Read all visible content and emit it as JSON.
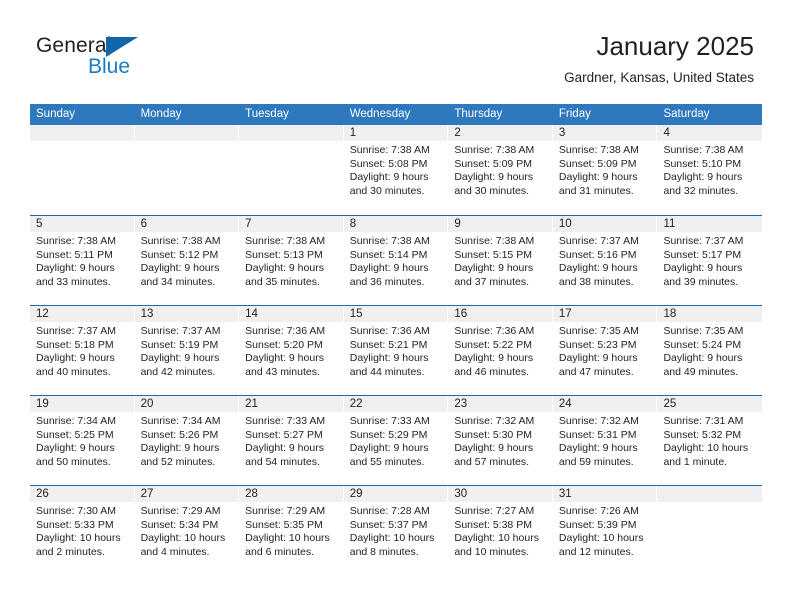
{
  "brand": {
    "name_top": "General",
    "name_bottom": "Blue",
    "accent_color": "#1265a8",
    "blue_text_color": "#1f7bc1"
  },
  "header": {
    "title": "January 2025",
    "subtitle": "Gardner, Kansas, United States"
  },
  "theme": {
    "header_bar_color": "#2e79bd",
    "row_divider_color": "#1a6bb0",
    "day_head_bg": "#f0f0f0",
    "text_color": "#231f20"
  },
  "weekdays": [
    "Sunday",
    "Monday",
    "Tuesday",
    "Wednesday",
    "Thursday",
    "Friday",
    "Saturday"
  ],
  "weeks": [
    [
      {
        "day": "",
        "lines": []
      },
      {
        "day": "",
        "lines": []
      },
      {
        "day": "",
        "lines": []
      },
      {
        "day": "1",
        "lines": [
          "Sunrise: 7:38 AM",
          "Sunset: 5:08 PM",
          "Daylight: 9 hours",
          "and 30 minutes."
        ]
      },
      {
        "day": "2",
        "lines": [
          "Sunrise: 7:38 AM",
          "Sunset: 5:09 PM",
          "Daylight: 9 hours",
          "and 30 minutes."
        ]
      },
      {
        "day": "3",
        "lines": [
          "Sunrise: 7:38 AM",
          "Sunset: 5:09 PM",
          "Daylight: 9 hours",
          "and 31 minutes."
        ]
      },
      {
        "day": "4",
        "lines": [
          "Sunrise: 7:38 AM",
          "Sunset: 5:10 PM",
          "Daylight: 9 hours",
          "and 32 minutes."
        ]
      }
    ],
    [
      {
        "day": "5",
        "lines": [
          "Sunrise: 7:38 AM",
          "Sunset: 5:11 PM",
          "Daylight: 9 hours",
          "and 33 minutes."
        ]
      },
      {
        "day": "6",
        "lines": [
          "Sunrise: 7:38 AM",
          "Sunset: 5:12 PM",
          "Daylight: 9 hours",
          "and 34 minutes."
        ]
      },
      {
        "day": "7",
        "lines": [
          "Sunrise: 7:38 AM",
          "Sunset: 5:13 PM",
          "Daylight: 9 hours",
          "and 35 minutes."
        ]
      },
      {
        "day": "8",
        "lines": [
          "Sunrise: 7:38 AM",
          "Sunset: 5:14 PM",
          "Daylight: 9 hours",
          "and 36 minutes."
        ]
      },
      {
        "day": "9",
        "lines": [
          "Sunrise: 7:38 AM",
          "Sunset: 5:15 PM",
          "Daylight: 9 hours",
          "and 37 minutes."
        ]
      },
      {
        "day": "10",
        "lines": [
          "Sunrise: 7:37 AM",
          "Sunset: 5:16 PM",
          "Daylight: 9 hours",
          "and 38 minutes."
        ]
      },
      {
        "day": "11",
        "lines": [
          "Sunrise: 7:37 AM",
          "Sunset: 5:17 PM",
          "Daylight: 9 hours",
          "and 39 minutes."
        ]
      }
    ],
    [
      {
        "day": "12",
        "lines": [
          "Sunrise: 7:37 AM",
          "Sunset: 5:18 PM",
          "Daylight: 9 hours",
          "and 40 minutes."
        ]
      },
      {
        "day": "13",
        "lines": [
          "Sunrise: 7:37 AM",
          "Sunset: 5:19 PM",
          "Daylight: 9 hours",
          "and 42 minutes."
        ]
      },
      {
        "day": "14",
        "lines": [
          "Sunrise: 7:36 AM",
          "Sunset: 5:20 PM",
          "Daylight: 9 hours",
          "and 43 minutes."
        ]
      },
      {
        "day": "15",
        "lines": [
          "Sunrise: 7:36 AM",
          "Sunset: 5:21 PM",
          "Daylight: 9 hours",
          "and 44 minutes."
        ]
      },
      {
        "day": "16",
        "lines": [
          "Sunrise: 7:36 AM",
          "Sunset: 5:22 PM",
          "Daylight: 9 hours",
          "and 46 minutes."
        ]
      },
      {
        "day": "17",
        "lines": [
          "Sunrise: 7:35 AM",
          "Sunset: 5:23 PM",
          "Daylight: 9 hours",
          "and 47 minutes."
        ]
      },
      {
        "day": "18",
        "lines": [
          "Sunrise: 7:35 AM",
          "Sunset: 5:24 PM",
          "Daylight: 9 hours",
          "and 49 minutes."
        ]
      }
    ],
    [
      {
        "day": "19",
        "lines": [
          "Sunrise: 7:34 AM",
          "Sunset: 5:25 PM",
          "Daylight: 9 hours",
          "and 50 minutes."
        ]
      },
      {
        "day": "20",
        "lines": [
          "Sunrise: 7:34 AM",
          "Sunset: 5:26 PM",
          "Daylight: 9 hours",
          "and 52 minutes."
        ]
      },
      {
        "day": "21",
        "lines": [
          "Sunrise: 7:33 AM",
          "Sunset: 5:27 PM",
          "Daylight: 9 hours",
          "and 54 minutes."
        ]
      },
      {
        "day": "22",
        "lines": [
          "Sunrise: 7:33 AM",
          "Sunset: 5:29 PM",
          "Daylight: 9 hours",
          "and 55 minutes."
        ]
      },
      {
        "day": "23",
        "lines": [
          "Sunrise: 7:32 AM",
          "Sunset: 5:30 PM",
          "Daylight: 9 hours",
          "and 57 minutes."
        ]
      },
      {
        "day": "24",
        "lines": [
          "Sunrise: 7:32 AM",
          "Sunset: 5:31 PM",
          "Daylight: 9 hours",
          "and 59 minutes."
        ]
      },
      {
        "day": "25",
        "lines": [
          "Sunrise: 7:31 AM",
          "Sunset: 5:32 PM",
          "Daylight: 10 hours",
          "and 1 minute."
        ]
      }
    ],
    [
      {
        "day": "26",
        "lines": [
          "Sunrise: 7:30 AM",
          "Sunset: 5:33 PM",
          "Daylight: 10 hours",
          "and 2 minutes."
        ]
      },
      {
        "day": "27",
        "lines": [
          "Sunrise: 7:29 AM",
          "Sunset: 5:34 PM",
          "Daylight: 10 hours",
          "and 4 minutes."
        ]
      },
      {
        "day": "28",
        "lines": [
          "Sunrise: 7:29 AM",
          "Sunset: 5:35 PM",
          "Daylight: 10 hours",
          "and 6 minutes."
        ]
      },
      {
        "day": "29",
        "lines": [
          "Sunrise: 7:28 AM",
          "Sunset: 5:37 PM",
          "Daylight: 10 hours",
          "and 8 minutes."
        ]
      },
      {
        "day": "30",
        "lines": [
          "Sunrise: 7:27 AM",
          "Sunset: 5:38 PM",
          "Daylight: 10 hours",
          "and 10 minutes."
        ]
      },
      {
        "day": "31",
        "lines": [
          "Sunrise: 7:26 AM",
          "Sunset: 5:39 PM",
          "Daylight: 10 hours",
          "and 12 minutes."
        ]
      },
      {
        "day": "",
        "lines": []
      }
    ]
  ]
}
